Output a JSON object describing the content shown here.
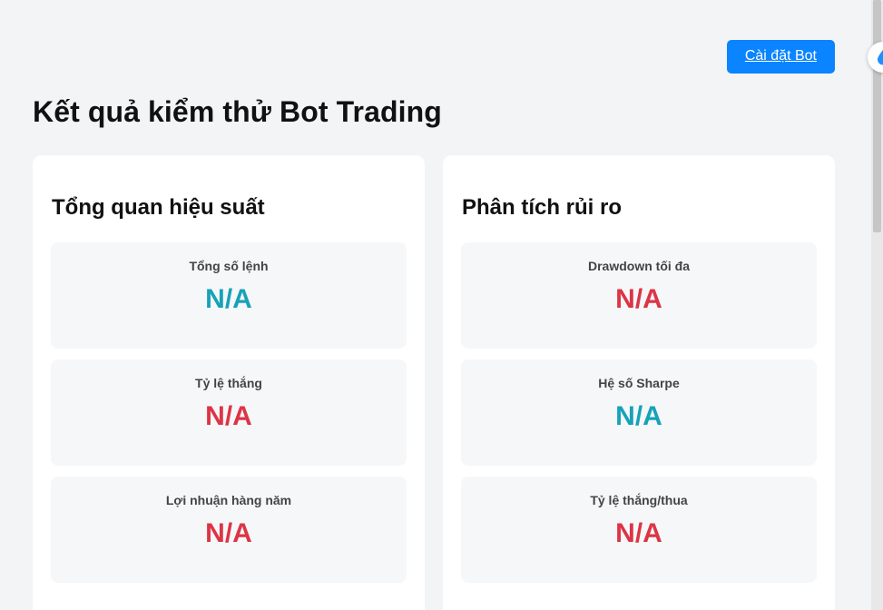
{
  "header": {
    "settings_button": "Cài đặt Bot",
    "title": "Kết quả kiểm thử Bot Trading"
  },
  "panels": [
    {
      "title": "Tổng quan hiệu suất",
      "metrics": [
        {
          "label": "Tổng số lệnh",
          "value": "N/A",
          "color": "#17a2b8"
        },
        {
          "label": "Tỷ lệ thắng",
          "value": "N/A",
          "color": "#dc3545"
        },
        {
          "label": "Lợi nhuận hàng năm",
          "value": "N/A",
          "color": "#dc3545"
        }
      ]
    },
    {
      "title": "Phân tích rủi ro",
      "metrics": [
        {
          "label": "Drawdown tối đa",
          "value": "N/A",
          "color": "#dc3545"
        },
        {
          "label": "Hệ số Sharpe",
          "value": "N/A",
          "color": "#17a2b8"
        },
        {
          "label": "Tỷ lệ thắng/thua",
          "value": "N/A",
          "color": "#dc3545"
        }
      ]
    }
  ],
  "colors": {
    "accent": "#0a84ff",
    "positive": "#17a2b8",
    "negative": "#dc3545"
  },
  "icons": {
    "floating_widget": "droplet-icon"
  }
}
